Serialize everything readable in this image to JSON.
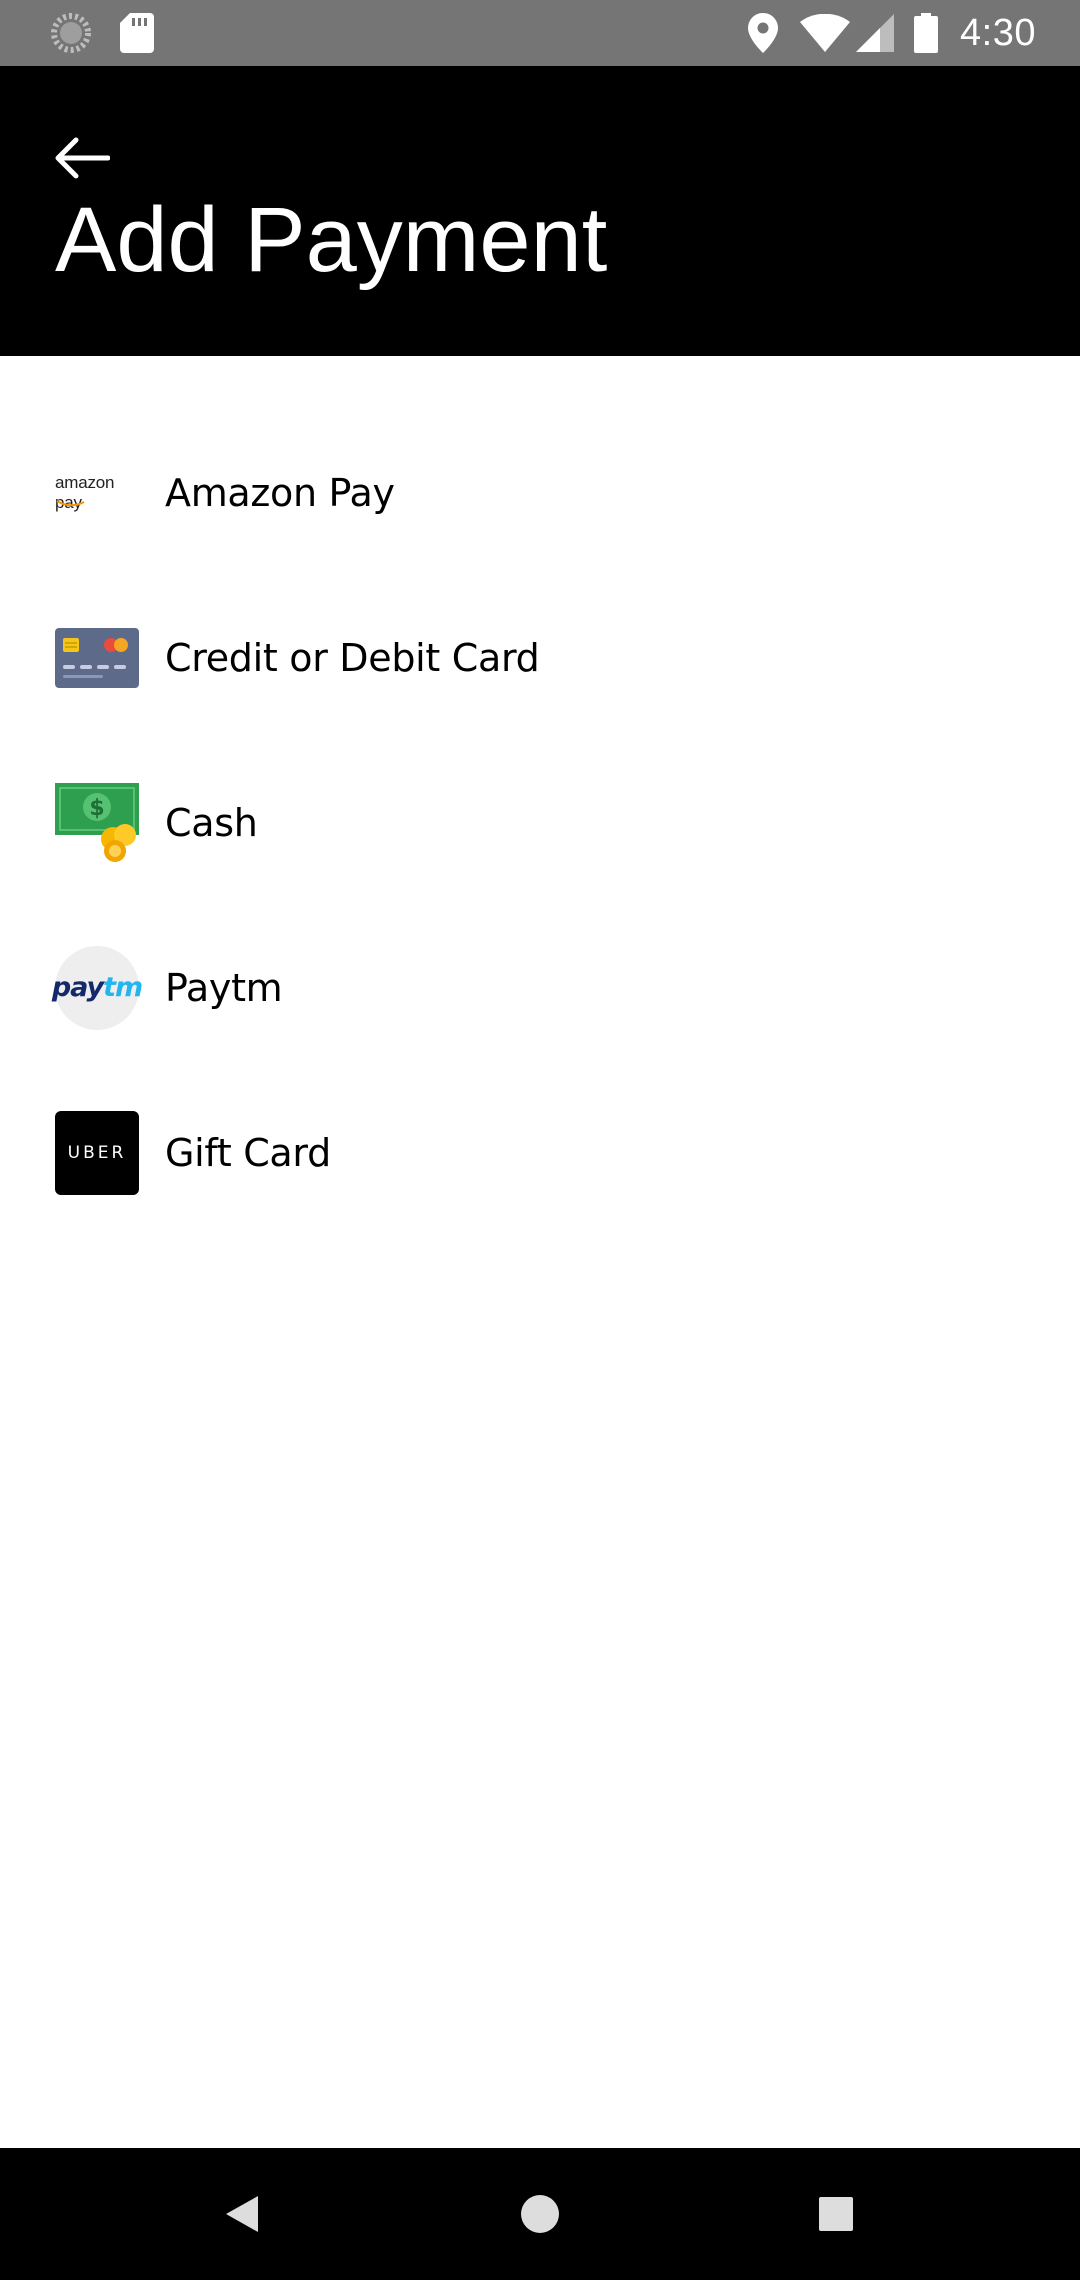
{
  "status_bar": {
    "time": "4:30",
    "icons": [
      "loading-icon",
      "sd-card-icon",
      "location-icon",
      "wifi-icon",
      "signal-icon",
      "battery-icon"
    ]
  },
  "header": {
    "title": "Add Payment",
    "back_icon": "arrow-left-icon"
  },
  "payment_methods": [
    {
      "label": "Amazon Pay",
      "logo": "amazon-pay-logo",
      "logo_text": "amazon pay"
    },
    {
      "label": "Credit or Debit Card",
      "logo": "credit-card-icon"
    },
    {
      "label": "Cash",
      "logo": "cash-icon"
    },
    {
      "label": "Paytm",
      "logo": "paytm-logo",
      "logo_text_pay": "pay",
      "logo_text_tm": "tm"
    },
    {
      "label": "Gift Card",
      "logo": "uber-gift-card-logo",
      "logo_text": "UBER"
    }
  ],
  "nav_bar": {
    "back": "nav-back-icon",
    "home": "nav-home-icon",
    "recents": "nav-recents-icon"
  },
  "colors": {
    "status_bar": "#757575",
    "app_bar": "#000000",
    "paytm_dark": "#14296b",
    "paytm_light": "#22b6ec",
    "cash_green": "#2e9e4f"
  }
}
